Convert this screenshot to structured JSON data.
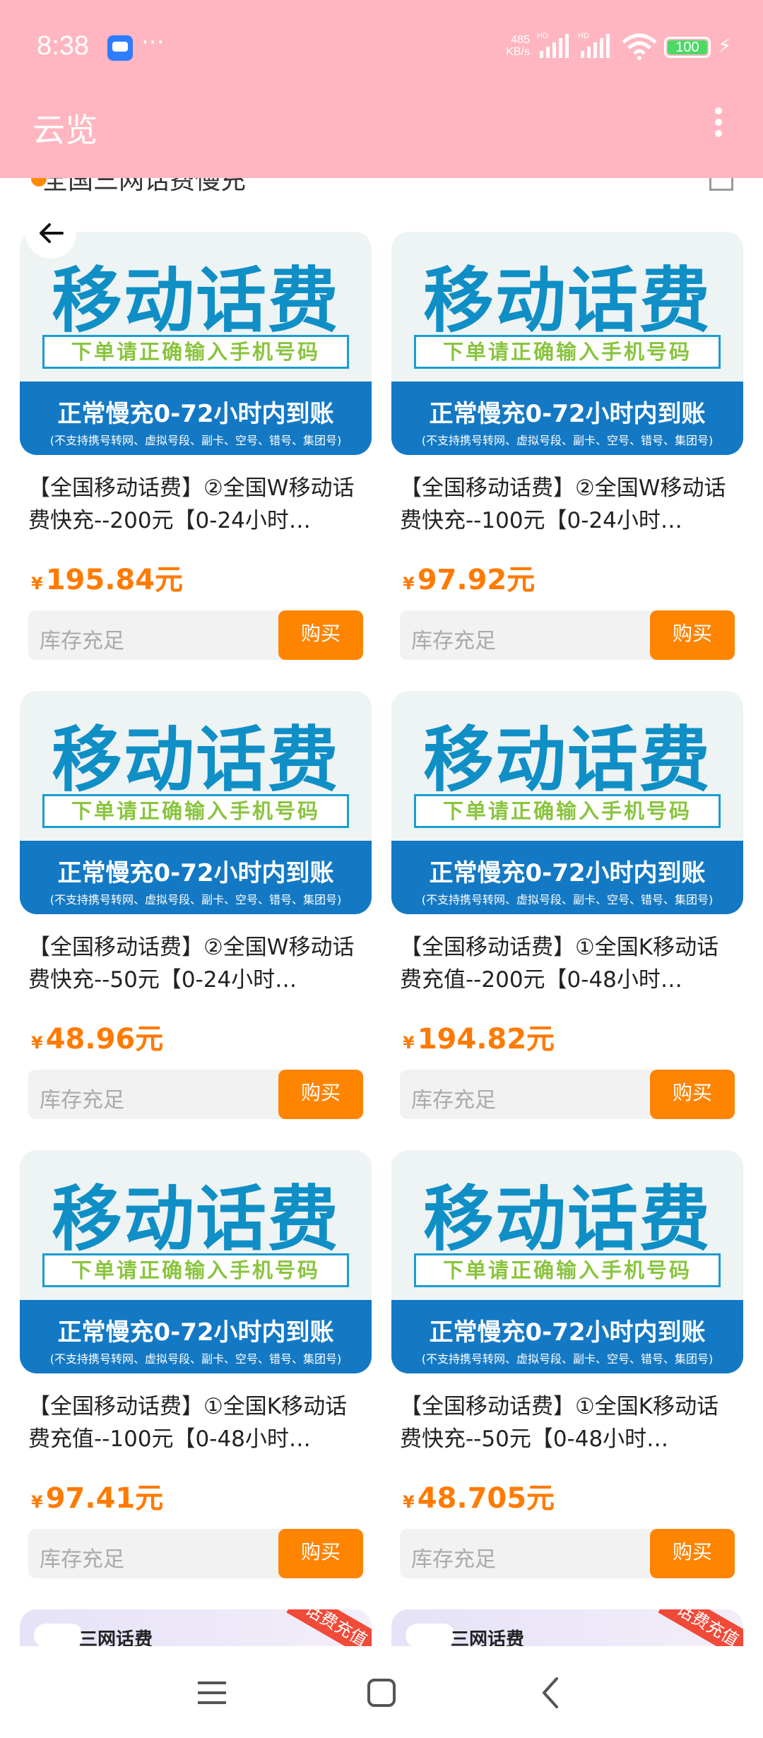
{
  "status_bar": {
    "time": "8:38",
    "dots": "···",
    "speed_value": "485",
    "speed_unit": "KB/s",
    "battery": "100"
  },
  "app_bar": {
    "title": "云览",
    "menu_icon": "more-vertical-icon"
  },
  "peek_title": "全国三网话费慢充",
  "back_icon": "arrow-left-icon",
  "banner": {
    "headline": "移动话费",
    "notice": "下单请正确输入手机号码",
    "blue_line1": "正常慢充0-72小时内到账",
    "blue_line2": "(不支持携号转网、虚拟号段、副卡、空号、错号、集团号)"
  },
  "products": [
    {
      "name": "【全国移动话费】②全国W移动话费快充--200元【0-24小时…",
      "currency": "¥",
      "price": "195.84元",
      "stock": "库存充足",
      "buy": "购买"
    },
    {
      "name": "【全国移动话费】②全国W移动话费快充--100元【0-24小时…",
      "currency": "¥",
      "price": "97.92元",
      "stock": "库存充足",
      "buy": "购买"
    },
    {
      "name": "【全国移动话费】②全国W移动话费快充--50元【0-24小时…",
      "currency": "¥",
      "price": "48.96元",
      "stock": "库存充足",
      "buy": "购买"
    },
    {
      "name": "【全国移动话费】①全国K移动话费充值--200元【0-48小时…",
      "currency": "¥",
      "price": "194.82元",
      "stock": "库存充足",
      "buy": "购买"
    },
    {
      "name": "【全国移动话费】①全国K移动话费充值--100元【0-48小时…",
      "currency": "¥",
      "price": "97.41元",
      "stock": "库存充足",
      "buy": "购买"
    },
    {
      "name": "【全国移动话费】①全国K移动话费快充--50元【0-48小时…",
      "currency": "¥",
      "price": "48.705元",
      "stock": "库存充足",
      "buy": "购买"
    }
  ],
  "promo": {
    "title": "三网话费",
    "ribbon": "话费充值"
  },
  "colors": {
    "app_bar": "#ffb6c1",
    "price": "#ff7a00",
    "buy_button": "#ff8400",
    "banner_blue": "#1479c4",
    "banner_headline": "#0f8fc5"
  },
  "nav_bar": {
    "menu_icon": "menu-icon",
    "home_icon": "home-square-icon",
    "back_icon": "back-chevron-icon"
  }
}
